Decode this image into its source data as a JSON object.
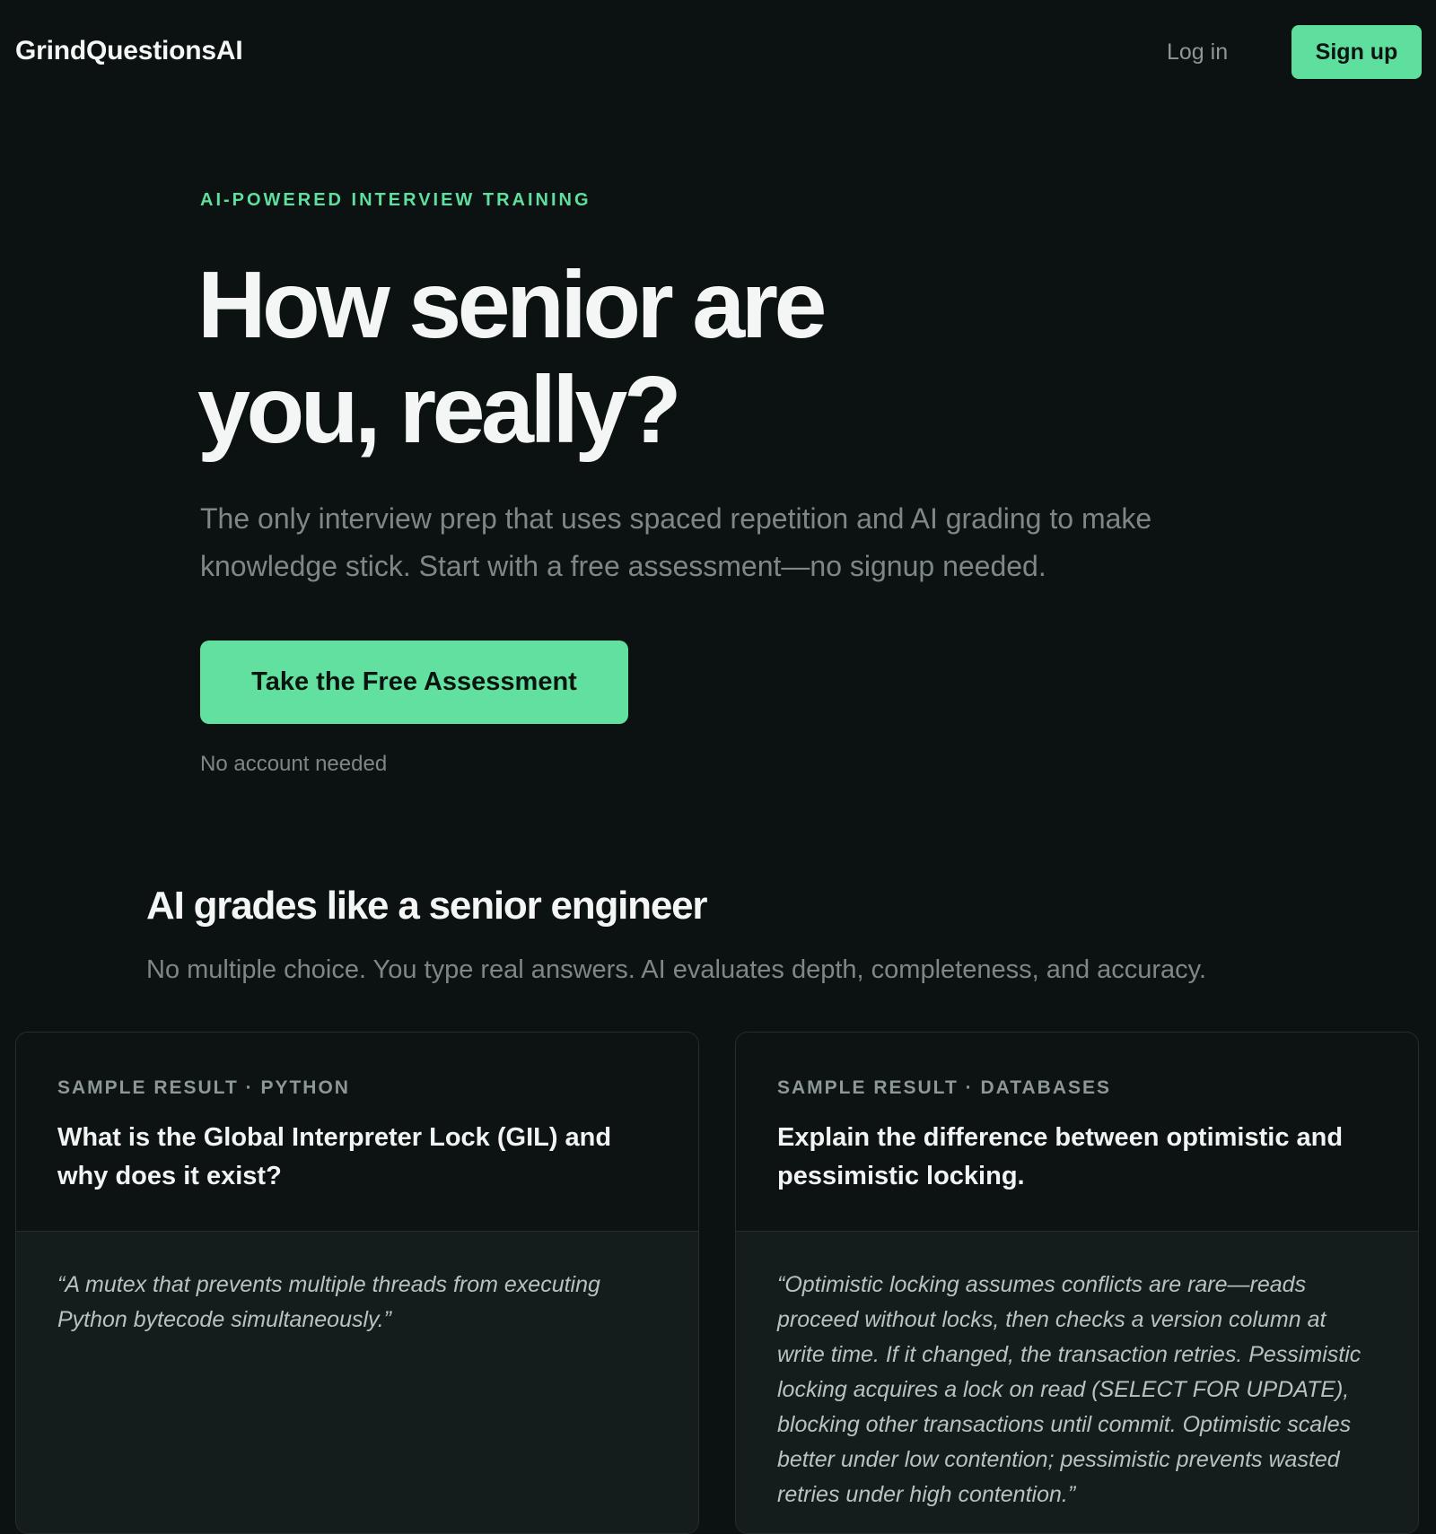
{
  "header": {
    "logo": "GrindQuestionsAI",
    "login_label": "Log in",
    "signup_label": "Sign up"
  },
  "hero": {
    "eyebrow": "AI-POWERED INTERVIEW TRAINING",
    "title_line1": "How senior are",
    "title_line2": "you, really?",
    "subtitle": "The only interview prep that uses spaced repetition and AI grading to make knowledge stick. Start with a free assessment—no signup needed.",
    "cta_label": "Take the Free Assessment",
    "cta_note": "No account needed"
  },
  "section": {
    "title": "AI grades like a senior engineer",
    "subtitle": "No multiple choice. You type real answers. AI evaluates depth, completeness, and accuracy."
  },
  "cards": [
    {
      "meta": "SAMPLE RESULT · PYTHON",
      "question": "What is the Global Interpreter Lock (GIL) and why does it exist?",
      "answer": "“A mutex that prevents multiple threads from executing Python bytecode simultaneously.”"
    },
    {
      "meta": "SAMPLE RESULT · DATABASES",
      "question": "Explain the difference between optimistic and pessimistic locking.",
      "answer": "“Optimistic locking assumes conflicts are rare—reads proceed without locks, then checks a version column at write time. If it changed, the transaction retries. Pessimistic locking acquires a lock on read (SELECT FOR UPDATE), blocking other transactions until commit. Optimistic scales better under low contention; pessimistic prevents wasted retries under high contention.”"
    }
  ],
  "colors": {
    "background": "#0c1212",
    "accent": "#5fdf9e",
    "muted_text": "#7d8885"
  }
}
